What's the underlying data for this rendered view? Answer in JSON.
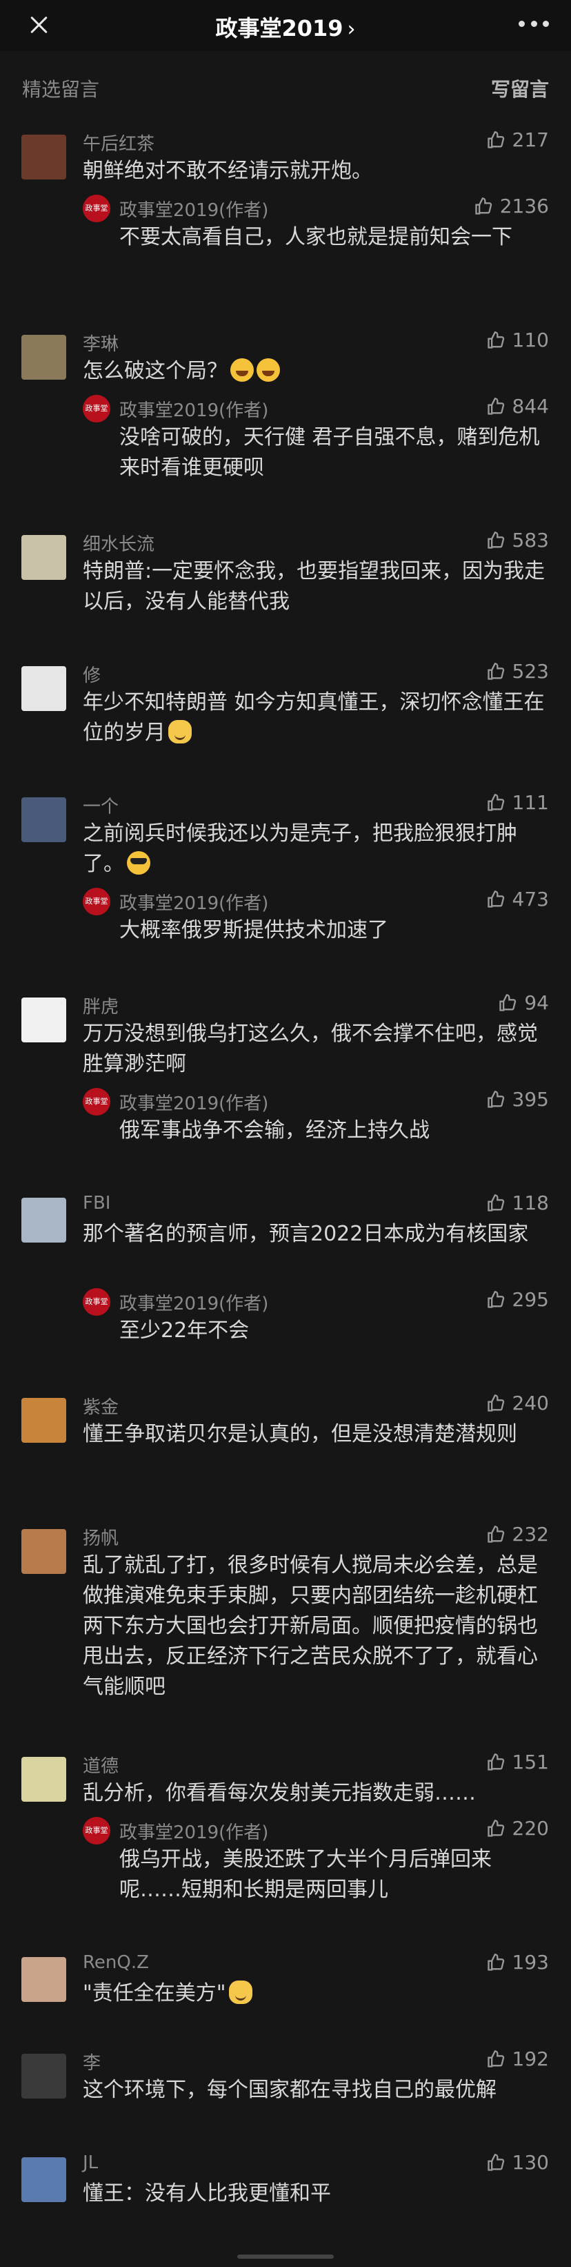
{
  "header": {
    "title": "政事堂2019",
    "title_chevron": "›"
  },
  "section": {
    "label": "精选留言",
    "write_label": "写留言"
  },
  "author_badge": "政事堂",
  "comments": [
    {
      "name": "午后红茶",
      "likes": "217",
      "text": "朝鲜绝对不敢不经请示就开炮。",
      "avatar_color": "#6b3a2a",
      "reply": {
        "name": "政事堂2019(作者)",
        "likes": "2136",
        "text": "不要太高看自己，人家也就是提前知会一下"
      }
    },
    {
      "name": "李琳",
      "likes": "110",
      "text": "怎么破这个局？",
      "emoji": "laugh",
      "avatar_color": "#8a7a5a",
      "reply": {
        "name": "政事堂2019(作者)",
        "likes": "844",
        "text": "没啥可破的，天行健 君子自强不息，赌到危机来时看谁更硬呗"
      }
    },
    {
      "name": "细水长流",
      "likes": "583",
      "text": "特朗普:一定要怀念我，也要指望我回来，因为我走以后，没有人能替代我",
      "avatar_color": "#c9c2a8"
    },
    {
      "name": "修",
      "likes": "523",
      "text": "年少不知特朗普 如今方知真懂王，深切怀念懂王在位的岁月",
      "emoji": "cat",
      "avatar_color": "#e6e6e6"
    },
    {
      "name": "一个",
      "likes": "111",
      "text": "之前阅兵时候我还以为是壳子，把我脸狠狠打肿了。",
      "emoji": "cool",
      "avatar_color": "#4a5a7a",
      "reply": {
        "name": "政事堂2019(作者)",
        "likes": "473",
        "text": "大概率俄罗斯提供技术加速了"
      }
    },
    {
      "name": "胖虎",
      "likes": "94",
      "text": "万万没想到俄乌打这么久，俄不会撑不住吧，感觉胜算渺茫啊",
      "avatar_color": "#f0f0f0",
      "reply": {
        "name": "政事堂2019(作者)",
        "likes": "395",
        "text": "俄军事战争不会输，经济上持久战"
      }
    },
    {
      "name": "FBI",
      "likes": "118",
      "text": "那个著名的预言师，预言2022日本成为有核国家",
      "avatar_color": "#a9b6c6",
      "reply": {
        "name": "政事堂2019(作者)",
        "likes": "295",
        "text": "至少22年不会"
      }
    },
    {
      "name": "紫金",
      "likes": "240",
      "text": "懂王争取诺贝尔是认真的，但是没想清楚潜规则",
      "avatar_color": "#c7843a"
    },
    {
      "name": "扬帆",
      "likes": "232",
      "text": "乱了就乱了打，很多时候有人搅局未必会差，总是做推演难免束手束脚，只要内部团结统一趁机硬杠两下东方大国也会打开新局面。顺便把疫情的锅也甩出去，反正经济下行之苦民众脱不了了，就看心气能顺吧",
      "avatar_color": "#b77a4a"
    },
    {
      "name": "道德",
      "likes": "151",
      "text": "乱分析，你看看每次发射美元指数走弱……",
      "avatar_color": "#d9d4a0",
      "reply": {
        "name": "政事堂2019(作者)",
        "likes": "220",
        "text": "俄乌开战，美股还跌了大半个月后弹回来呢……短期和长期是两回事儿"
      }
    },
    {
      "name": "RenQ.Z",
      "likes": "193",
      "text": "\"责任全在美方\"",
      "emoji": "cat",
      "avatar_color": "#c9a48a"
    },
    {
      "name": "李",
      "likes": "192",
      "text": "这个环境下，每个国家都在寻找自己的最优解",
      "avatar_color": "#3a3a3a"
    },
    {
      "name": "JL",
      "likes": "130",
      "text": "懂王：没有人比我更懂和平",
      "avatar_color": "#5a7ab0"
    }
  ]
}
